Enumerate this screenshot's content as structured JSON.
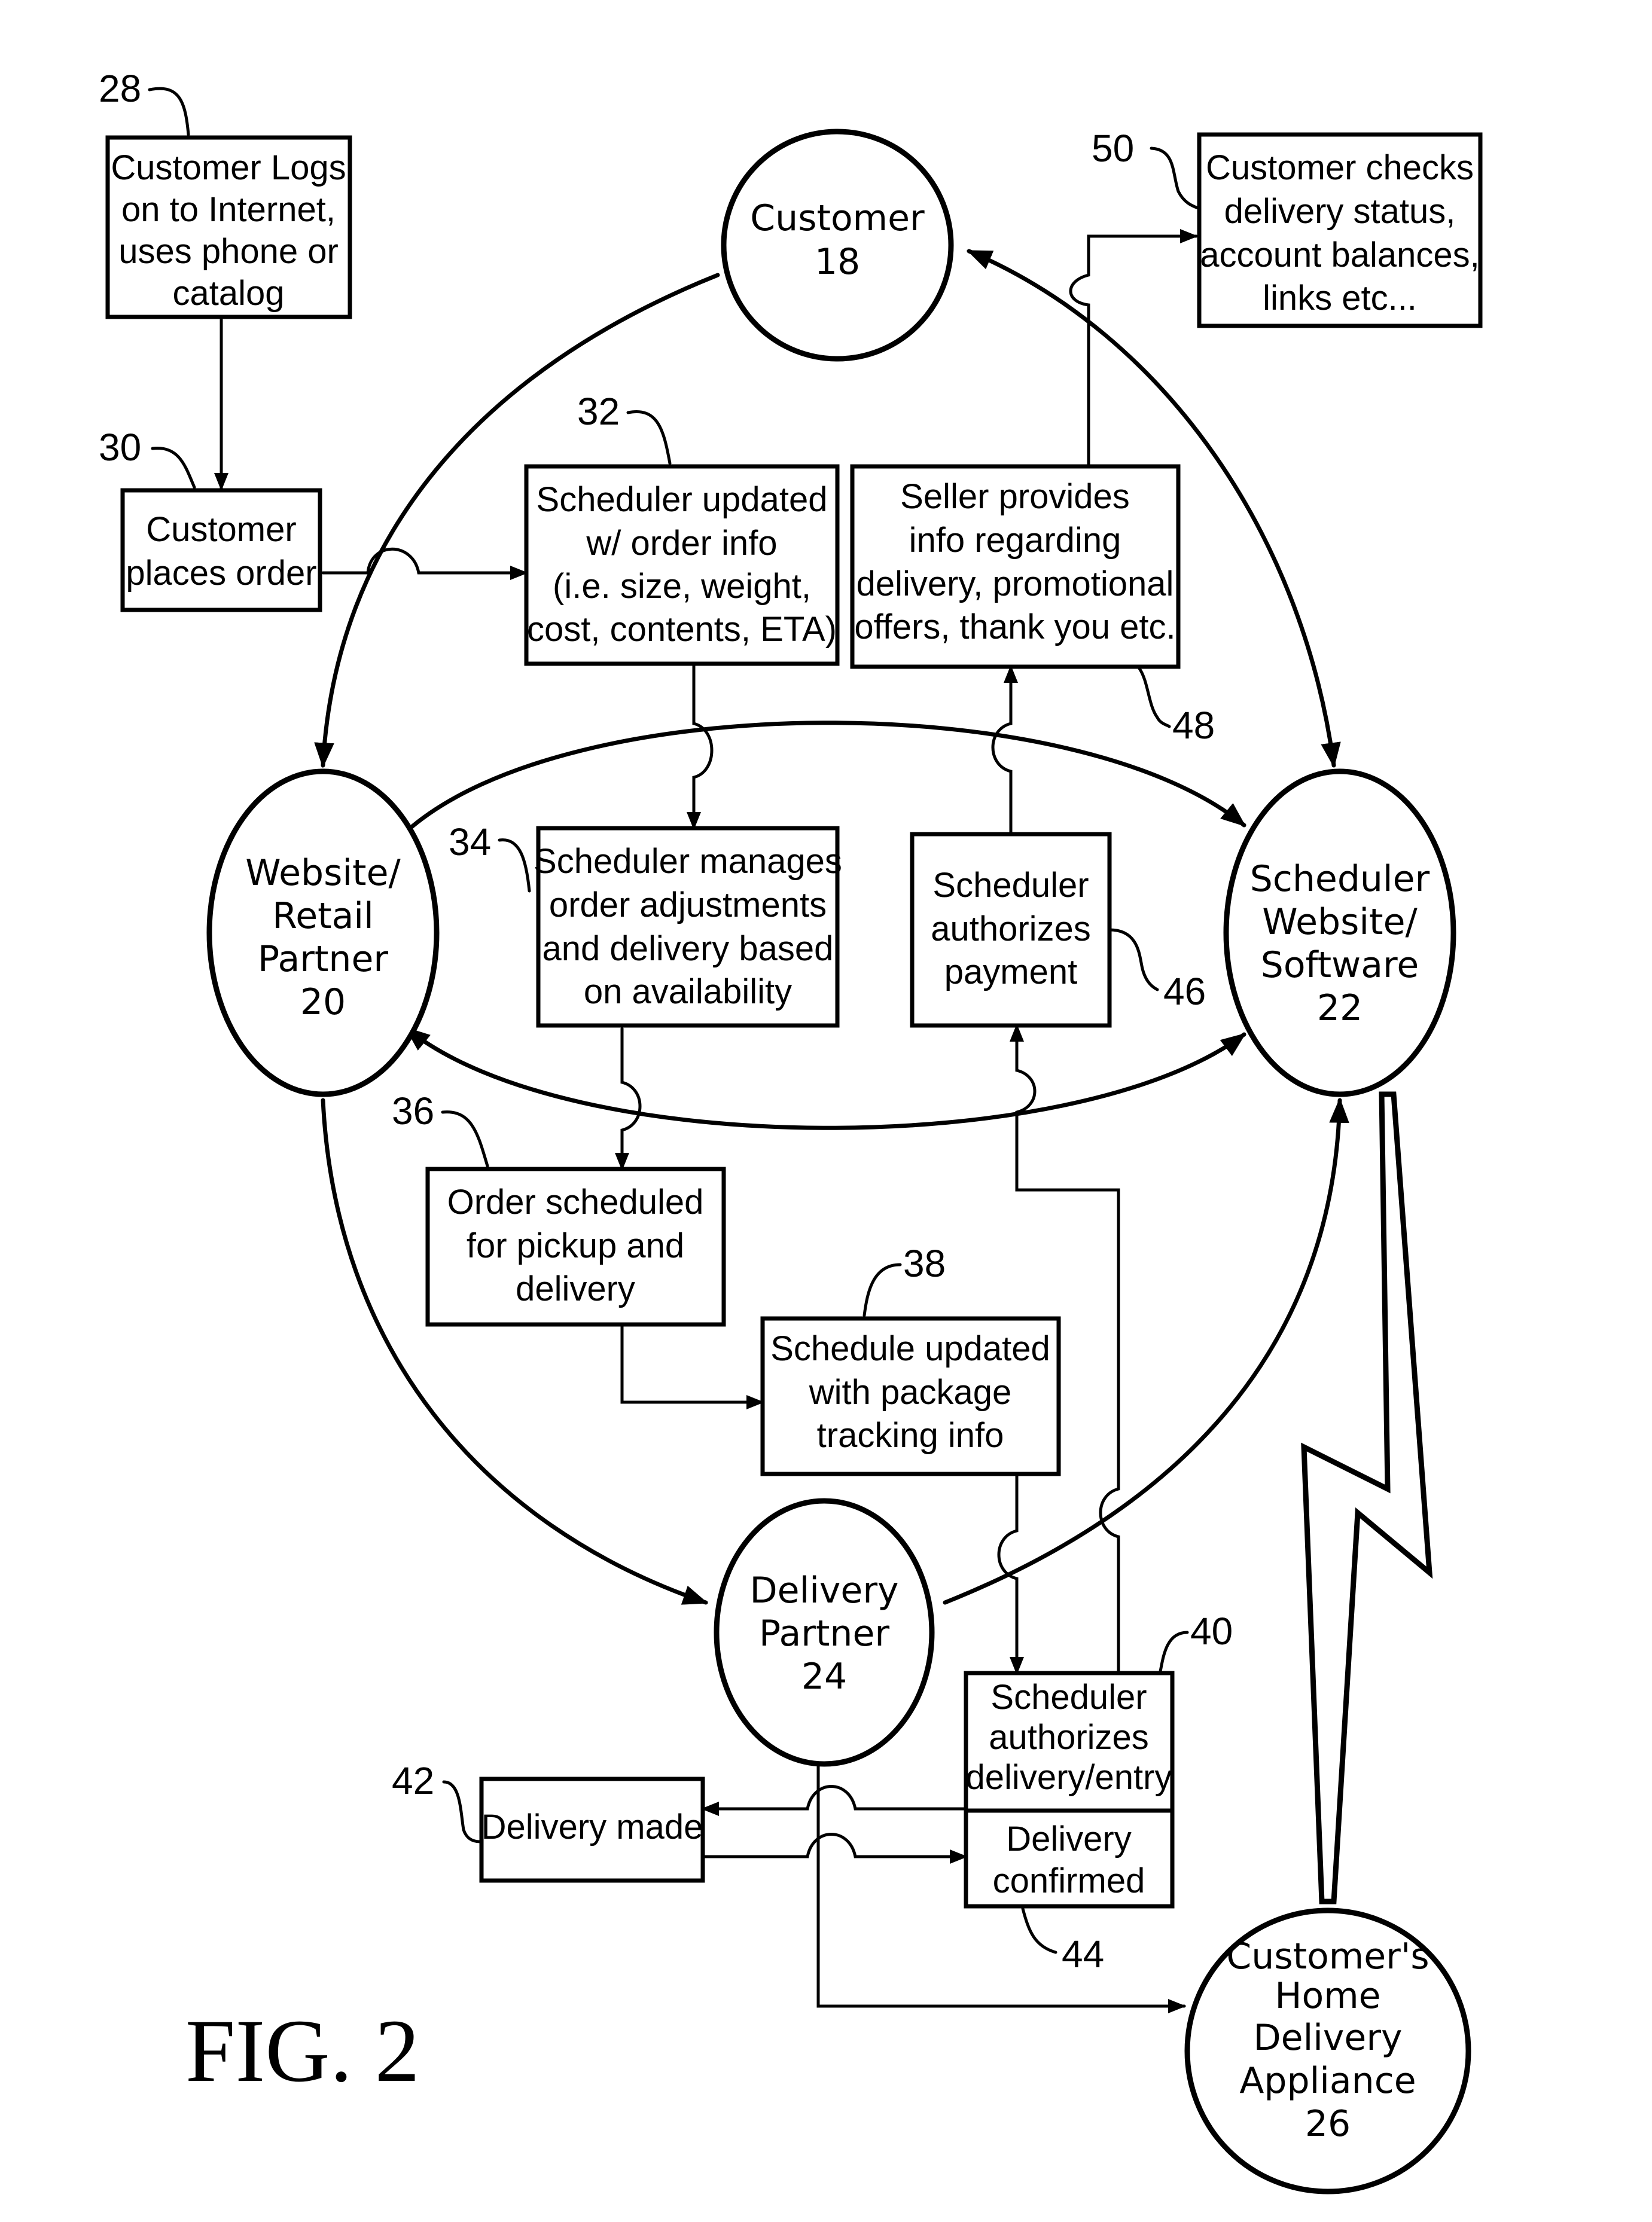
{
  "figure": {
    "label": "FIG. 2"
  },
  "nodes": {
    "customer": {
      "lines": [
        "Customer",
        "18"
      ]
    },
    "retail": {
      "lines": [
        "Website/",
        "Retail",
        "Partner",
        "20"
      ]
    },
    "scheduler": {
      "lines": [
        "Scheduler",
        "Website/",
        "Software",
        "22"
      ]
    },
    "delivery_partner": {
      "lines": [
        "Delivery",
        "Partner",
        "24"
      ]
    },
    "appliance": {
      "lines": [
        "Customer's",
        "Home",
        "Delivery",
        "Appliance",
        "26"
      ]
    }
  },
  "boxes": {
    "b28": {
      "ref": "28",
      "lines": [
        "Customer Logs",
        "on to Internet,",
        "uses phone or",
        "catalog"
      ]
    },
    "b30": {
      "ref": "30",
      "lines": [
        "Customer",
        "places order"
      ]
    },
    "b32": {
      "ref": "32",
      "lines": [
        "Scheduler updated",
        "w/ order info",
        "(i.e. size, weight,",
        "cost, contents, ETA)"
      ]
    },
    "b34": {
      "ref": "34",
      "lines": [
        "Scheduler manages",
        "order adjustments",
        "and delivery based",
        "on availability"
      ]
    },
    "b36": {
      "ref": "36",
      "lines": [
        "Order scheduled",
        "for pickup and",
        "delivery"
      ]
    },
    "b38": {
      "ref": "38",
      "lines": [
        "Schedule updated",
        "with package",
        "tracking info"
      ]
    },
    "b40": {
      "ref": "40",
      "lines": [
        "Scheduler",
        "authorizes",
        "delivery/entry"
      ]
    },
    "b42": {
      "ref": "42",
      "lines": [
        "Delivery made"
      ]
    },
    "b44": {
      "ref": "44",
      "lines": [
        "Delivery",
        "confirmed"
      ]
    },
    "b46": {
      "ref": "46",
      "lines": [
        "Scheduler",
        "authorizes",
        "payment"
      ]
    },
    "b48": {
      "ref": "48",
      "lines": [
        "Seller provides",
        "info regarding",
        "delivery, promotional",
        "offers, thank you etc."
      ]
    },
    "b50": {
      "ref": "50",
      "lines": [
        "Customer checks",
        "delivery status,",
        "account balances,",
        "links etc..."
      ]
    }
  }
}
